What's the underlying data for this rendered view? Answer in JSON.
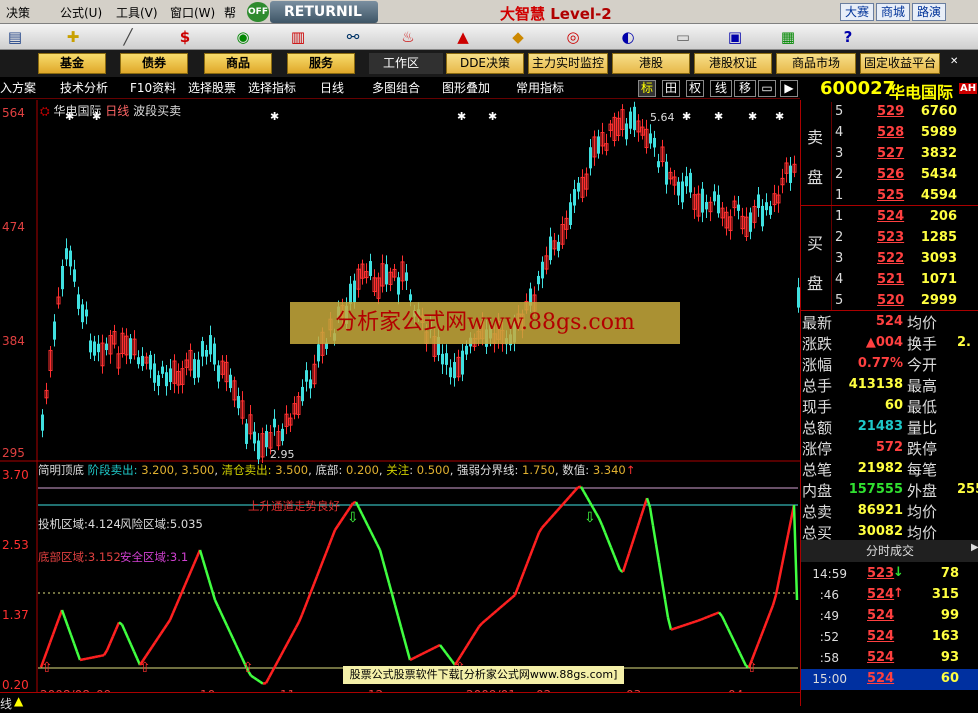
{
  "menubar": {
    "items": [
      "决策",
      "公式(U)",
      "工具(V)",
      "窗口(W)",
      "帮"
    ],
    "badge": "OFF",
    "returnil": "RETURNIL",
    "brand": "大智慧",
    "level": "Level-2",
    "buttons": [
      "大赛",
      "商城",
      "路演"
    ]
  },
  "catbar": {
    "buttons": [
      "基金",
      "债券",
      "商品",
      "服务"
    ],
    "workarea": "工作区",
    "buttons2": [
      "DDE决策",
      "主力实时监控",
      "港股",
      "港股权证",
      "商品市场",
      "固定收益平台"
    ]
  },
  "charttoolbar": {
    "items": [
      "入方案",
      "技术分析",
      "F10资料",
      "选择股票",
      "选择指标",
      "日线",
      "多图组合",
      "图形叠加",
      "常用指标"
    ],
    "toggles": [
      "标",
      "田",
      "权",
      "线",
      "移"
    ]
  },
  "stock": {
    "code": "600027",
    "name": "华电国际",
    "tag": "AH"
  },
  "chart": {
    "title": "华电国际",
    "period": "日线",
    "indicator": "波段买卖",
    "high_label": "5.64",
    "low_label": "2.95",
    "y_labels": [
      "564",
      "474",
      "384",
      "295"
    ],
    "sub_title": "简明顶底",
    "sub_params": [
      {
        "k": "阶段卖出",
        "v": "3.200, 3.500"
      },
      {
        "k": "清仓卖出",
        "v": "3.500"
      },
      {
        "k": "底部",
        "v": "0.200"
      },
      {
        "k": "关注",
        "v": "0.500"
      },
      {
        "k": "强弱分界线",
        "v": "1.750"
      },
      {
        "k": "数值",
        "v": "3.340"
      }
    ],
    "sub_y": [
      "3.70",
      "2.53",
      "1.37",
      "0.20"
    ],
    "zones": [
      {
        "text": "投机区域:4.124"
      },
      {
        "text": "风险区域:5.035"
      },
      {
        "text": "底部区域:3.152"
      },
      {
        "text": "安全区域:3.1"
      }
    ],
    "channel_note": "上升通道走势良好",
    "x_labels": [
      "2008/08",
      "09",
      "10",
      "11",
      "12",
      "2009/01",
      "02",
      "03",
      "04"
    ]
  },
  "watermark": "分析家公式网www.88gs.com",
  "footnote": "股票公式股票软件下载[分析家公式网www.88gs.com]",
  "status": {
    "left": "线"
  },
  "orderbook": {
    "sell_label": [
      "卖",
      "盘"
    ],
    "buy_label": [
      "买",
      "盘"
    ],
    "sell": [
      {
        "n": "5",
        "p": "529",
        "v": "6760"
      },
      {
        "n": "4",
        "p": "528",
        "v": "5989"
      },
      {
        "n": "3",
        "p": "527",
        "v": "3832"
      },
      {
        "n": "2",
        "p": "526",
        "v": "5434"
      },
      {
        "n": "1",
        "p": "525",
        "v": "4594"
      }
    ],
    "buy": [
      {
        "n": "1",
        "p": "524",
        "v": "206"
      },
      {
        "n": "2",
        "p": "523",
        "v": "1285"
      },
      {
        "n": "3",
        "p": "522",
        "v": "3093"
      },
      {
        "n": "4",
        "p": "521",
        "v": "1071"
      },
      {
        "n": "5",
        "p": "520",
        "v": "2999"
      }
    ]
  },
  "quote": [
    {
      "l": "最新",
      "v": "524",
      "r": "均价",
      "rv": ""
    },
    {
      "l": "涨跌",
      "v": "▲004",
      "r": "换手",
      "rv": "2."
    },
    {
      "l": "涨幅",
      "v": "0.77%",
      "r": "今开",
      "rv": ""
    },
    {
      "l": "总手",
      "v": "413138",
      "r": "最高",
      "rv": ""
    },
    {
      "l": "现手",
      "v": "60",
      "r": "最低",
      "rv": ""
    },
    {
      "l": "总额",
      "v": "21483",
      "r": "量比",
      "rv": ""
    },
    {
      "l": "涨停",
      "v": "572",
      "r": "跌停",
      "rv": ""
    },
    {
      "l": "总笔",
      "v": "21982",
      "r": "每笔",
      "rv": ""
    },
    {
      "l": "内盘",
      "v": "157555",
      "r": "外盘",
      "rv": "255"
    },
    {
      "l": "总卖",
      "v": "86921",
      "r": "均价",
      "rv": ""
    },
    {
      "l": "总买",
      "v": "30082",
      "r": "均价",
      "rv": ""
    }
  ],
  "ticks_title": "分时成交",
  "ticks": [
    {
      "t": "14:59",
      "p": "523",
      "d": "↓",
      "v": "78"
    },
    {
      "t": ":46",
      "p": "524",
      "d": "↑",
      "v": "315"
    },
    {
      "t": ":49",
      "p": "524",
      "d": "",
      "v": "99"
    },
    {
      "t": ":52",
      "p": "524",
      "d": "",
      "v": "163"
    },
    {
      "t": ":58",
      "p": "524",
      "d": "",
      "v": "93"
    },
    {
      "t": "15:00",
      "p": "524",
      "d": "",
      "v": "60"
    }
  ]
}
